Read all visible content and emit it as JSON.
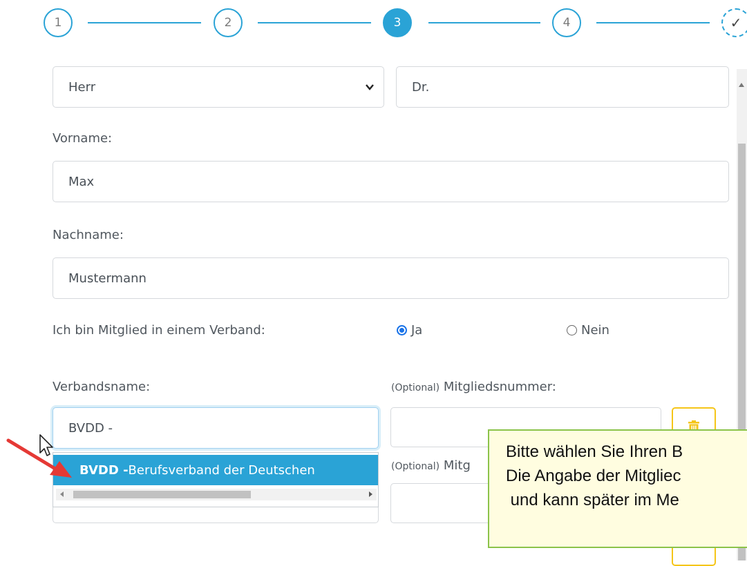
{
  "stepper": {
    "steps": [
      "1",
      "2",
      "3",
      "4",
      "✓"
    ],
    "active_step": "3",
    "accent_color": "#2aa3d6"
  },
  "form": {
    "salutation": {
      "value": "Herr"
    },
    "title": {
      "value": "Dr."
    },
    "first_name": {
      "label": "Vorname:",
      "value": "Max"
    },
    "last_name": {
      "label": "Nachname:",
      "value": "Mustermann"
    },
    "membership": {
      "label": "Ich bin Mitglied in einem Verband:",
      "options": [
        "Ja",
        "Nein"
      ],
      "selected": "Ja"
    },
    "association": {
      "label": "Verbandsname:",
      "value": "BVDD -",
      "member_number_optional": "(Optional)",
      "member_number_label": "Mitgliedsnummer:",
      "member_number_label_cut": "Mitg"
    },
    "dropdown": {
      "item_bold": "BVDD -",
      "item_rest": " Berufsverband der Deutschen"
    }
  },
  "tooltip": {
    "line1": "Bitte wählen Sie Ihren B",
    "line2": "Die Angabe der Mitgliec",
    "line3": " und kann später im Me"
  },
  "icons": [
    "trash-icon",
    "chevron-down-icon",
    "check-icon",
    "mouse-cursor-icon",
    "red-arrow-annotation"
  ]
}
